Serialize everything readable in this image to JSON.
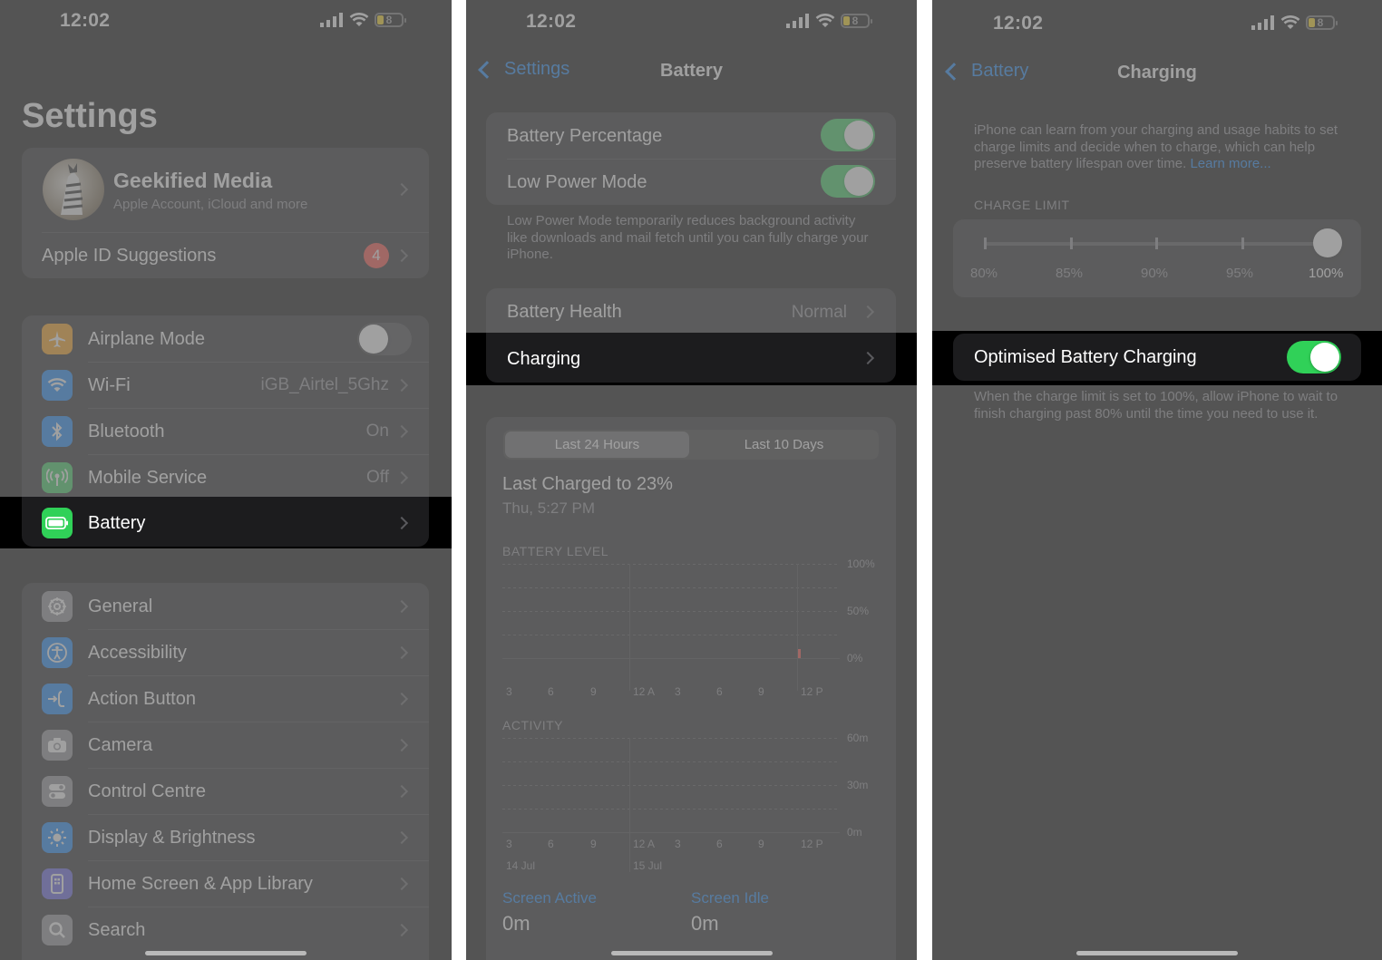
{
  "status": {
    "time": "12:02",
    "battery_level": "8"
  },
  "colors": {
    "accent": "#0a84ff",
    "toggle_on": "#30d158",
    "badge": "#ff453a",
    "battery_yellow": "#ffd60a"
  },
  "settings": {
    "title": "Settings",
    "profile": {
      "name": "Geekified Media",
      "subtitle": "Apple Account, iCloud and more"
    },
    "suggestions": {
      "label": "Apple ID Suggestions",
      "badge": "4"
    },
    "connectivity": [
      {
        "label": "Airplane Mode",
        "value": "",
        "icon": "airplane-icon",
        "color": "#ff9f0a",
        "toggle": "off"
      },
      {
        "label": "Wi-Fi",
        "value": "iGB_Airtel_5Ghz",
        "icon": "wifi-icon",
        "color": "#0a84ff"
      },
      {
        "label": "Bluetooth",
        "value": "On",
        "icon": "bluetooth-icon",
        "color": "#0a84ff"
      },
      {
        "label": "Mobile Service",
        "value": "Off",
        "icon": "antenna-icon",
        "color": "#30d158"
      }
    ],
    "battery_row": {
      "label": "Battery",
      "icon": "battery-icon",
      "color": "#30d158"
    },
    "general": [
      {
        "label": "General",
        "icon": "gear-icon",
        "color": "#8e8e93"
      },
      {
        "label": "Accessibility",
        "icon": "accessibility-icon",
        "color": "#0a84ff"
      },
      {
        "label": "Action Button",
        "icon": "action-button-icon",
        "color": "#0a84ff"
      },
      {
        "label": "Camera",
        "icon": "camera-icon",
        "color": "#8e8e93"
      },
      {
        "label": "Control Centre",
        "icon": "control-centre-icon",
        "color": "#8e8e93"
      },
      {
        "label": "Display & Brightness",
        "icon": "sun-icon",
        "color": "#0a84ff"
      },
      {
        "label": "Home Screen & App Library",
        "icon": "home-screen-icon",
        "color": "#5e5ce6"
      },
      {
        "label": "Search",
        "icon": "search-icon",
        "color": "#8e8e93"
      }
    ]
  },
  "battery": {
    "back": "Settings",
    "title": "Battery",
    "percentage_label": "Battery Percentage",
    "percentage_toggle": "on",
    "low_power_label": "Low Power Mode",
    "low_power_toggle": "on",
    "low_power_note": "Low Power Mode temporarily reduces background activity like downloads and mail fetch until you can fully charge your iPhone.",
    "health_label": "Battery Health",
    "health_value": "Normal",
    "charging_label": "Charging",
    "segments": [
      "Last 24 Hours",
      "Last 10 Days"
    ],
    "selected_segment": "Last 24 Hours",
    "last_charged": "Last Charged to 23%",
    "last_charged_time": "Thu, 5:27 PM",
    "level_caption": "BATTERY LEVEL",
    "level_axis": [
      "100%",
      "50%",
      "0%"
    ],
    "time_ticks": [
      "3",
      "6",
      "9",
      "12 A",
      "3",
      "6",
      "9",
      "12 P"
    ],
    "activity_caption": "ACTIVITY",
    "activity_axis": [
      "60m",
      "30m",
      "0m"
    ],
    "date_labels": [
      "14 Jul",
      "15 Jul"
    ],
    "screen_active_label": "Screen Active",
    "screen_active_value": "0m",
    "screen_idle_label": "Screen Idle",
    "screen_idle_value": "0m"
  },
  "charging": {
    "back": "Battery",
    "title": "Charging",
    "intro": "iPhone can learn from your charging and usage habits to set charge limits and decide when to charge, which can help preserve battery lifespan over time.",
    "learn_more": "Learn more...",
    "limit_caption": "CHARGE LIMIT",
    "limit_options": [
      "80%",
      "85%",
      "90%",
      "95%",
      "100%"
    ],
    "limit_selected": "100%",
    "optimised_label": "Optimised Battery Charging",
    "optimised_toggle": "on",
    "optimised_note": "When the charge limit is set to 100%, allow iPhone to wait to finish charging past 80% until the time you need to use it."
  }
}
